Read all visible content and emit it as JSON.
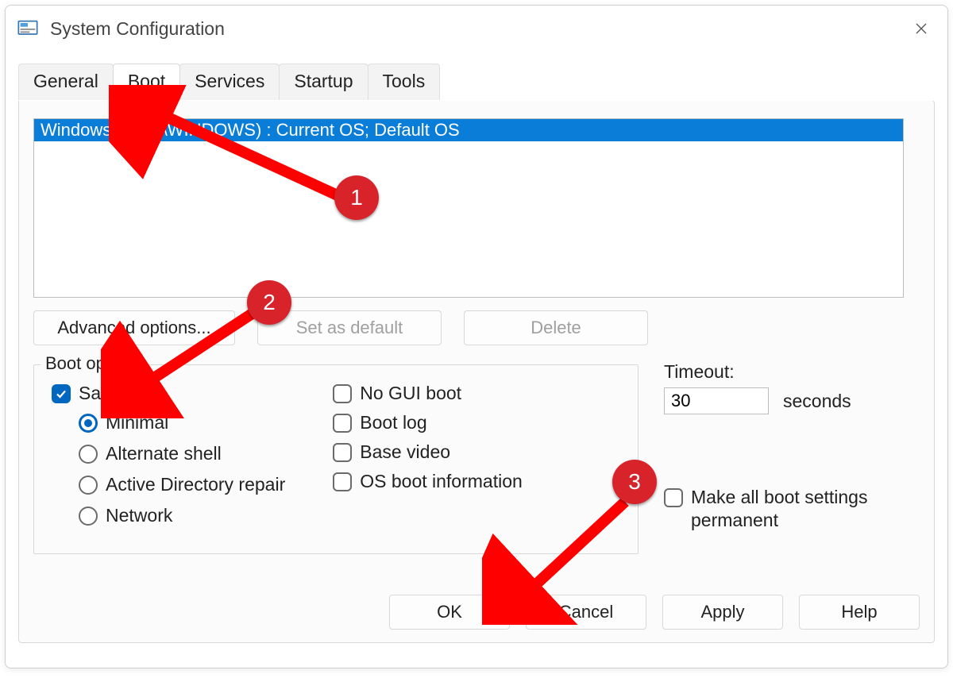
{
  "window": {
    "title": "System Configuration"
  },
  "tabs": {
    "items": [
      "General",
      "Boot",
      "Services",
      "Startup",
      "Tools"
    ],
    "active_index": 1
  },
  "boot": {
    "os_entry": "Windows 11 (C:\\WINDOWS) : Current OS; Default OS",
    "buttons": {
      "advanced": "Advanced options...",
      "set_default": "Set as default",
      "delete": "Delete"
    },
    "options_legend": "Boot options",
    "safe_boot": {
      "label": "Safe boot",
      "checked": true,
      "radios": {
        "minimal": "Minimal",
        "alt_shell": "Alternate shell",
        "ad_repair": "Active Directory repair",
        "network": "Network"
      },
      "selected": "minimal"
    },
    "flags": {
      "no_gui": "No GUI boot",
      "boot_log": "Boot log",
      "base_video": "Base video",
      "os_info": "OS boot information"
    },
    "timeout": {
      "label": "Timeout:",
      "value": "30",
      "unit": "seconds"
    },
    "permanent": "Make all boot settings permanent"
  },
  "footer": {
    "ok": "OK",
    "cancel": "Cancel",
    "apply": "Apply",
    "help": "Help"
  },
  "annotations": {
    "b1": "1",
    "b2": "2",
    "b3": "3"
  }
}
